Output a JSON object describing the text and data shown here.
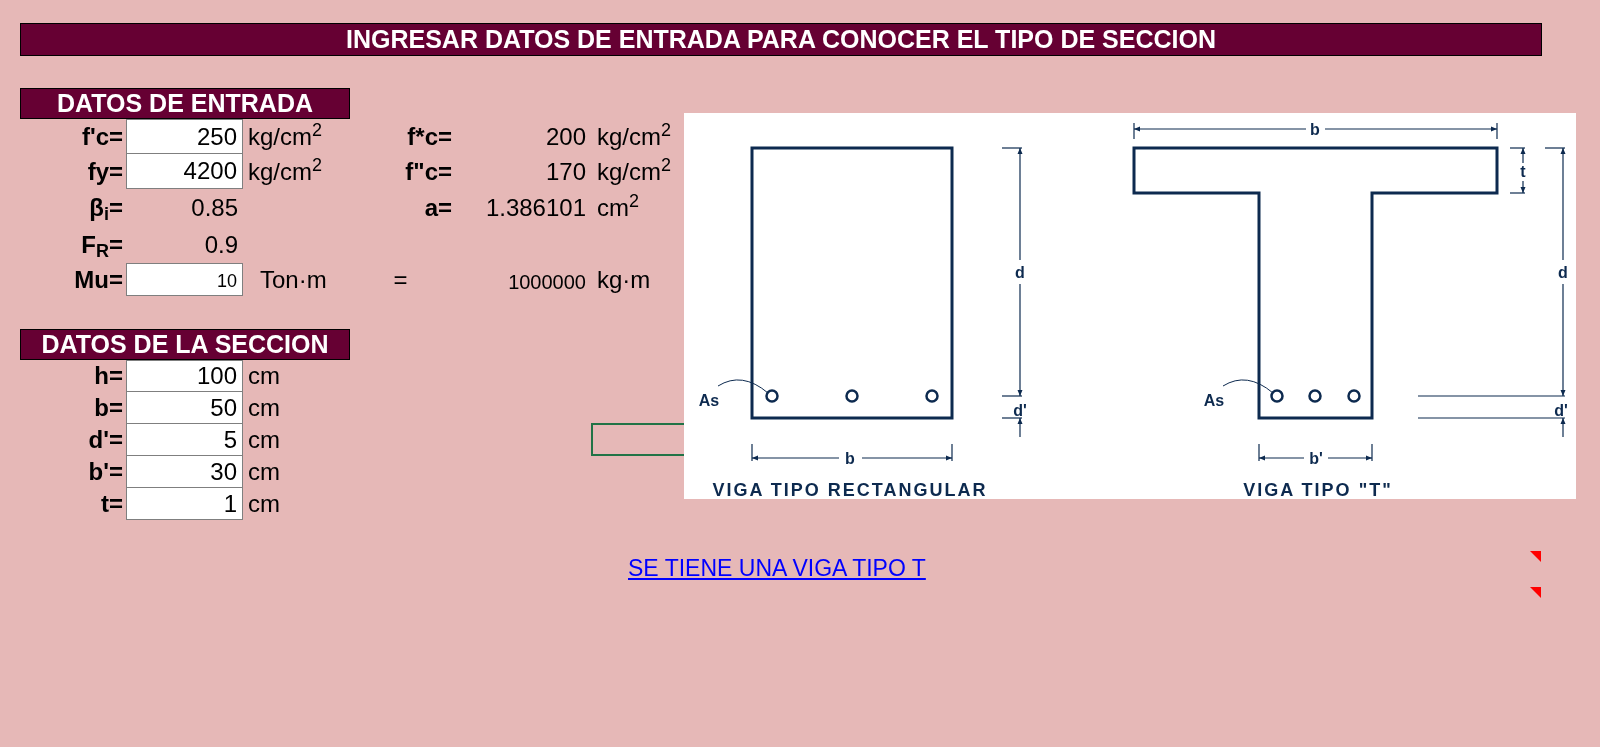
{
  "header": {
    "title": "INGRESAR DATOS DE ENTRADA PARA CONOCER EL TIPO DE SECCION"
  },
  "entrada": {
    "title": "DATOS DE ENTRADA",
    "rows": [
      {
        "kind": "input",
        "label": "f'c=",
        "value": "250",
        "unit": "kg/cm$^{2}$",
        "result": {
          "label": "f*c=",
          "value": "200",
          "unit": "kg/cm$^{2}$"
        }
      },
      {
        "kind": "input",
        "label": "fy=",
        "value": "4200",
        "unit": "kg/cm$^{2}$",
        "result": {
          "label": "f\"c=",
          "value": "170",
          "unit": "kg/cm$^{2}$"
        }
      },
      {
        "kind": "constant",
        "label": "β$_{i}$=",
        "value": "0.85",
        "result": {
          "label": "a=",
          "value": "1.386101",
          "unit": "cm$^{2}$"
        }
      },
      {
        "kind": "constant",
        "label": "F$_{R}$=",
        "value": "0.9"
      },
      {
        "kind": "conversion",
        "label": "Mu=",
        "value": "10",
        "unit": "Ton·m",
        "result": {
          "label": "=",
          "value": "1000000",
          "unit": "kg·m"
        }
      }
    ]
  },
  "seccion": {
    "title": "DATOS DE LA SECCION",
    "rows": [
      {
        "label": "h=",
        "value": "100",
        "unit": "cm"
      },
      {
        "label": "b=",
        "value": "50",
        "unit": "cm"
      },
      {
        "label": "d'=",
        "value": "5",
        "unit": "cm"
      },
      {
        "label": "b'=",
        "value": "30",
        "unit": "cm"
      },
      {
        "label": "t=",
        "value": "1",
        "unit": "cm"
      }
    ]
  },
  "diagram": {
    "rectangular": {
      "steel_label": "As",
      "d": "d",
      "d_prime": "d'",
      "b": "b",
      "caption": "VIGA TIPO RECTANGULAR"
    },
    "t_beam": {
      "b": "b",
      "t": "t",
      "d": "d",
      "d_prime": "d'",
      "steel_label": "As",
      "b_prime": "b'",
      "caption": "VIGA TIPO \"T\""
    }
  },
  "result_link": "SE TIENE UNA VIGA TIPO T"
}
